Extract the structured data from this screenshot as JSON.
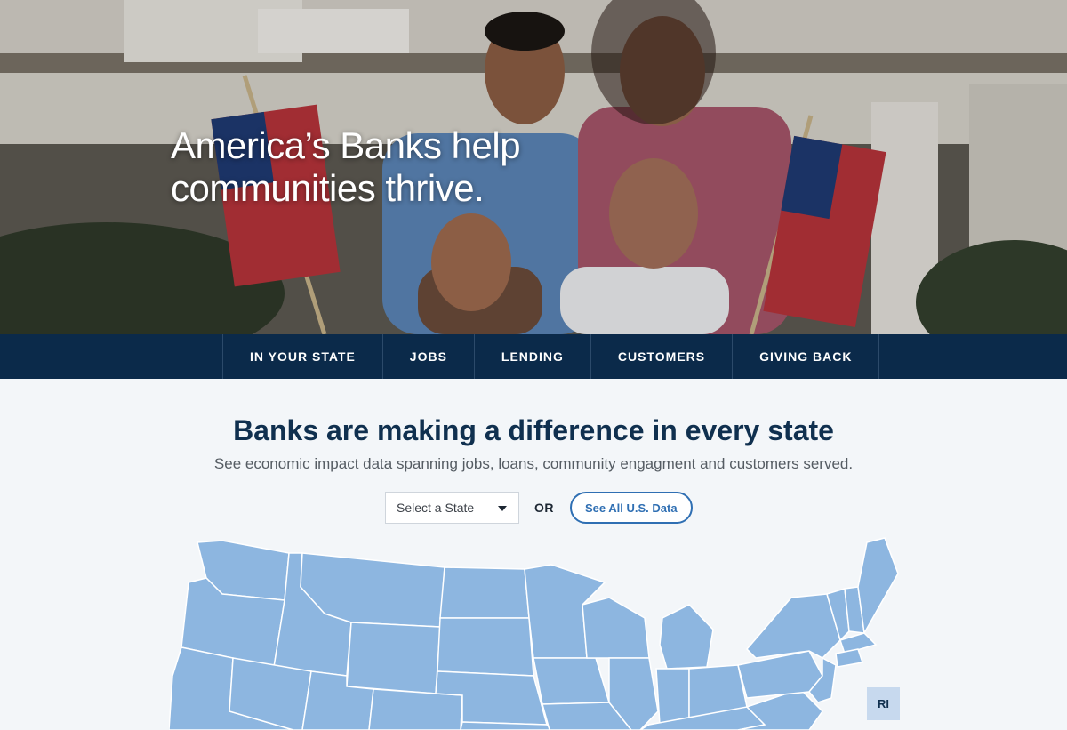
{
  "hero": {
    "title": "America’s Banks help communities thrive."
  },
  "nav": {
    "items": [
      {
        "label": "IN YOUR STATE"
      },
      {
        "label": "JOBS"
      },
      {
        "label": "LENDING"
      },
      {
        "label": "CUSTOMERS"
      },
      {
        "label": "GIVING BACK"
      }
    ]
  },
  "main": {
    "headline": "Banks are making a difference in every state",
    "subheadline": "See economic impact data spanning jobs, loans, community engagment and customers served.",
    "state_select": {
      "placeholder": "Select a State"
    },
    "or_label": "OR",
    "see_all_button": "See All U.S. Data",
    "map_badge": "RI"
  },
  "colors": {
    "nav_bg": "#0b2a4a",
    "map_fill": "#8db6e0",
    "map_stroke": "#ffffff",
    "heading": "#10304f",
    "button_accent": "#2f6fb3"
  }
}
